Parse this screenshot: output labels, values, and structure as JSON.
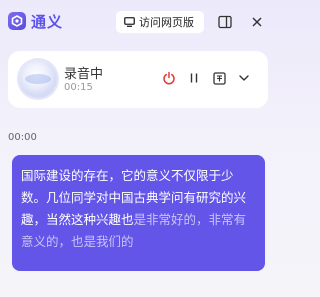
{
  "header": {
    "app_name": "通义",
    "logo_icon": "tongyi-logo-icon",
    "web_button_label": "访问网页版",
    "web_button_icon": "monitor-icon",
    "sidebar_icon": "sidebar-toggle-icon",
    "close_icon": "close-icon"
  },
  "recording": {
    "title": "录音中",
    "duration": "00:15",
    "controls": [
      "power-icon",
      "pause-icon",
      "translate-icon",
      "chevron-down-icon"
    ],
    "accent": "#e53935"
  },
  "transcript": {
    "timestamp": "00:00",
    "confirmed_text": "国际建设的存在，它的意义不仅限于少数。几位同学对中国古典学问有研究的兴趣，当然这种兴趣也",
    "pending_text": "是非常好的，非常有意义的，也是我们的",
    "bubble_color": "#6355e8"
  }
}
